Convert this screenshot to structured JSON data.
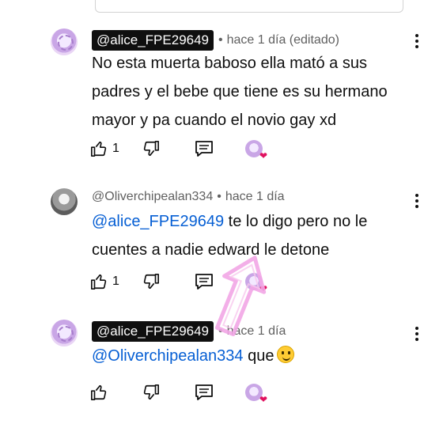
{
  "comments": [
    {
      "handle": "@alice_FPE29649",
      "time": "hace 1 día (editado)",
      "text": "No esta muerta baboso ella mató a sus padres y el bebe que tiene es su hermano mayor y pa cuando el novio gay xd",
      "likes": "1"
    },
    {
      "handle": "@Oliverchipealan334",
      "time": "hace 1 día",
      "mention": "@alice_FPE29649",
      "text": " te lo digo pero no le cuentes a nadie edward le detone",
      "likes": "1"
    },
    {
      "handle": "@alice_FPE29649",
      "time": "hace 1 día",
      "mention": "@Oliverchipealan334",
      "text": "  que",
      "emoji": "winking-face-emoji",
      "likes": ""
    }
  ],
  "icons": [
    "like-icon",
    "dislike-icon",
    "reply-icon",
    "creator-heart-icon",
    "more-options-icon"
  ],
  "colors": {
    "mention": "#065fd4",
    "heart": "#e0115f",
    "annotation_arrow": "#f2a6e6"
  }
}
